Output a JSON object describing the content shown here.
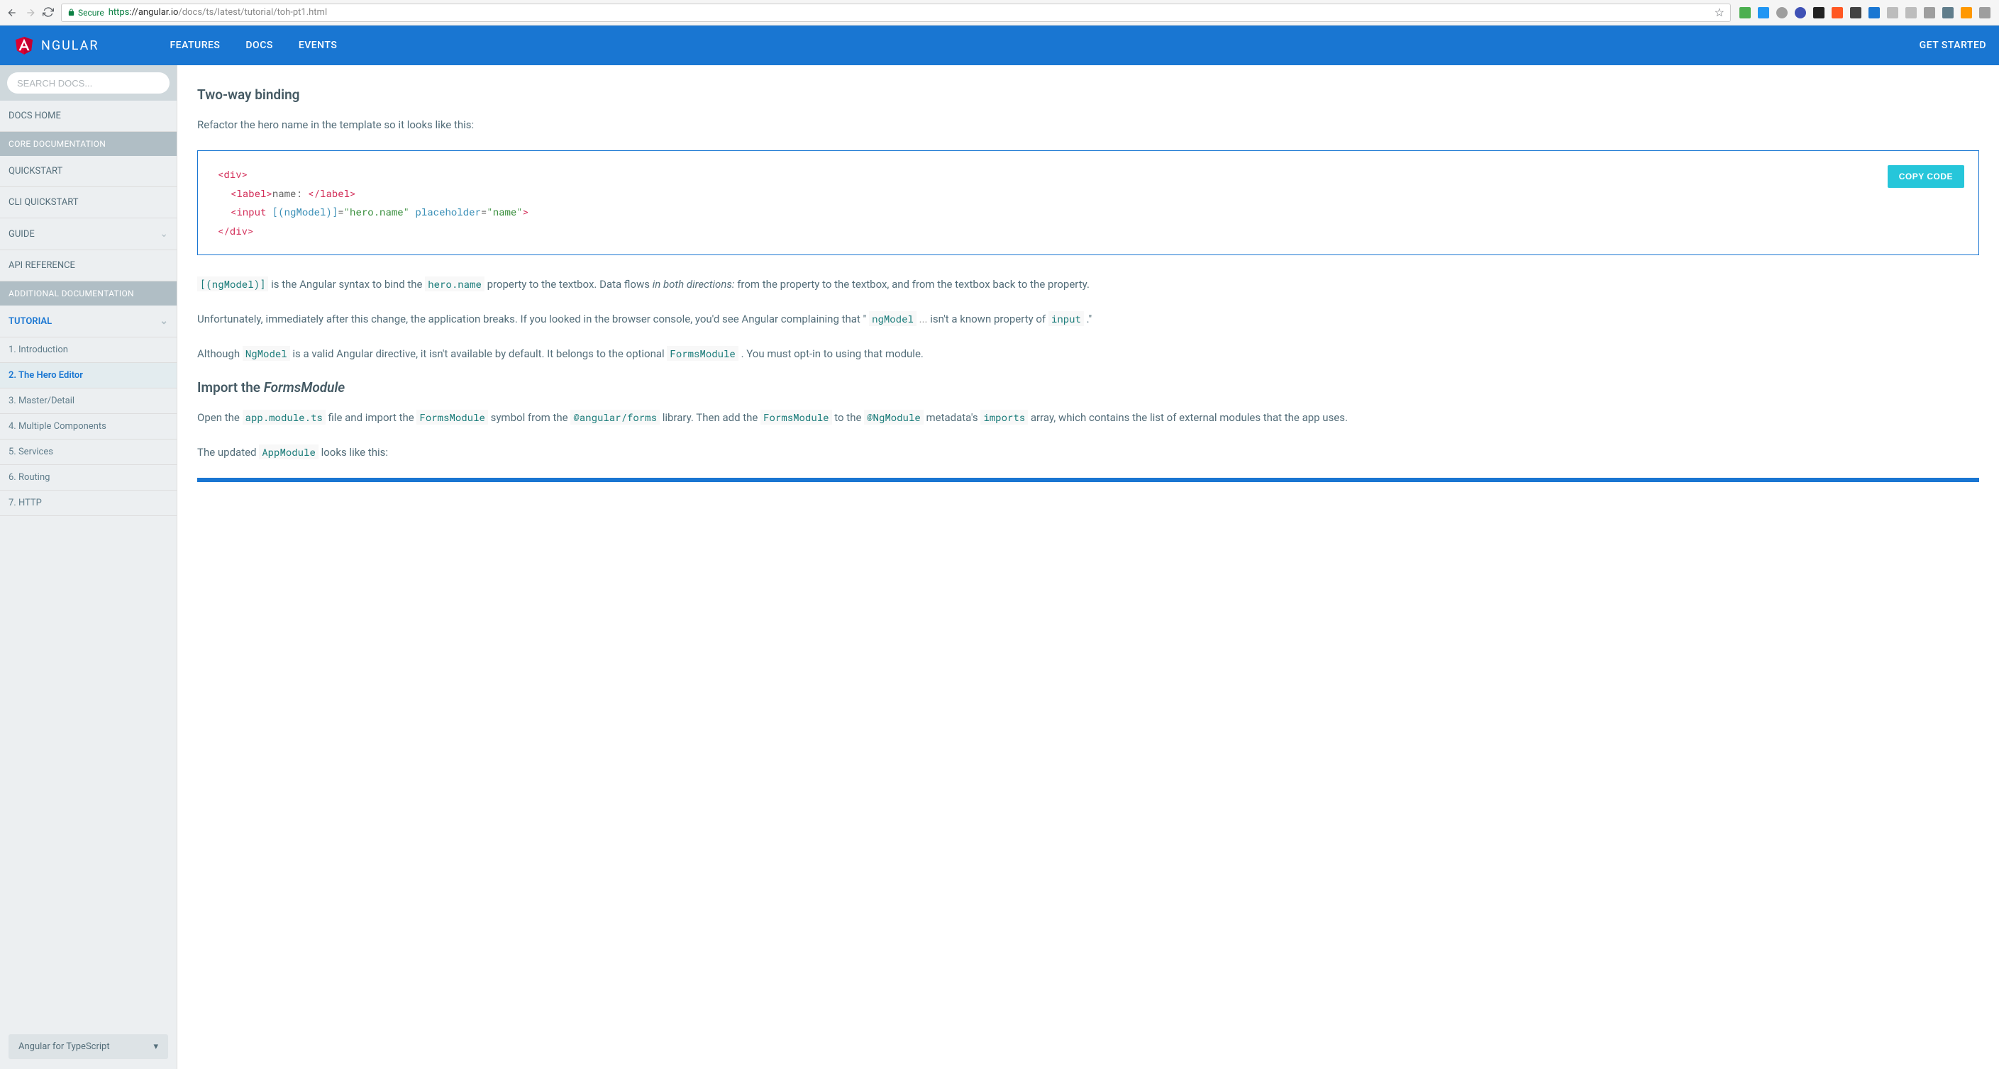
{
  "browser": {
    "secure_label": "Secure",
    "url_proto": "https",
    "url_host": "://angular.io",
    "url_path": "/docs/ts/latest/tutorial/toh-pt1.html"
  },
  "nav": {
    "logo_text": "NGULAR",
    "links": [
      "FEATURES",
      "DOCS",
      "EVENTS"
    ],
    "cta": "GET STARTED"
  },
  "sidebar": {
    "search_placeholder": "SEARCH DOCS...",
    "docs_home": "DOCS HOME",
    "section_core": "CORE DOCUMENTATION",
    "quickstart": "QUICKSTART",
    "cli_quickstart": "CLI QUICKSTART",
    "guide": "GUIDE",
    "api_reference": "API REFERENCE",
    "section_additional": "ADDITIONAL DOCUMENTATION",
    "tutorial": "TUTORIAL",
    "tutorial_items": [
      "1. Introduction",
      "2. The Hero Editor",
      "3. Master/Detail",
      "4. Multiple Components",
      "5. Services",
      "6. Routing",
      "7. HTTP"
    ],
    "lang_select": "Angular for TypeScript"
  },
  "content": {
    "h_twoway": "Two-way binding",
    "p_refactor": "Refactor the hero name in the template so it looks like this:",
    "copy_label": "COPY CODE",
    "code": {
      "l1_open": "<div>",
      "l2_open": "<label>",
      "l2_text": "name: ",
      "l2_close": "</label>",
      "l3_open": "<input ",
      "l3_attr1": "[(ngModel)]",
      "l3_eq1": "=",
      "l3_val1": "\"hero.name\"",
      "l3_attr2": " placeholder",
      "l3_eq2": "=",
      "l3_val2": "\"name\"",
      "l3_close": ">",
      "l4_close": "</div>"
    },
    "ic_ngmodel_syntax": "[(ngModel)]",
    "p_ngmodel_1": " is the Angular syntax to bind the ",
    "ic_heroname": "hero.name",
    "p_ngmodel_2": " property to the textbox. Data flows ",
    "p_ngmodel_emph": "in both directions:",
    "p_ngmodel_3": " from the property to the textbox, and from the textbox back to the property.",
    "p_unfort_1": "Unfortunately, immediately after this change, the application breaks. If you looked in the browser console, you'd see Angular complaining that \" ",
    "ic_ngmodel2": "ngModel",
    "p_unfort_ellipsis": " ...",
    "p_unfort_2": " isn't a known property of ",
    "ic_input": "input",
    "p_unfort_3": " .\"",
    "p_although_1": "Although ",
    "ic_NgModel": "NgModel",
    "p_although_2": " is a valid Angular directive, it isn't available by default. It belongs to the optional ",
    "ic_FormsModule": "FormsModule",
    "p_although_3": " . You must opt-in to using that module.",
    "h_import_1": "Import the ",
    "h_import_2": "FormsModule",
    "p_open_1": "Open the ",
    "ic_appmodule": "app.module.ts",
    "p_open_2": " file and import the ",
    "ic_FormsModule2": "FormsModule",
    "p_open_3": " symbol from the ",
    "ic_angularforms": "@angular/forms",
    "p_open_4": " library. Then add the ",
    "ic_FormsModule3": "FormsModule",
    "p_open_5": " to the ",
    "ic_NgModule": "@NgModule",
    "p_open_6": " metadata's ",
    "ic_imports": "imports",
    "p_open_7": " array, which contains the list of external modules that the app uses.",
    "p_updated_1": "The updated ",
    "ic_AppModule": "AppModule",
    "p_updated_2": " looks like this:"
  }
}
